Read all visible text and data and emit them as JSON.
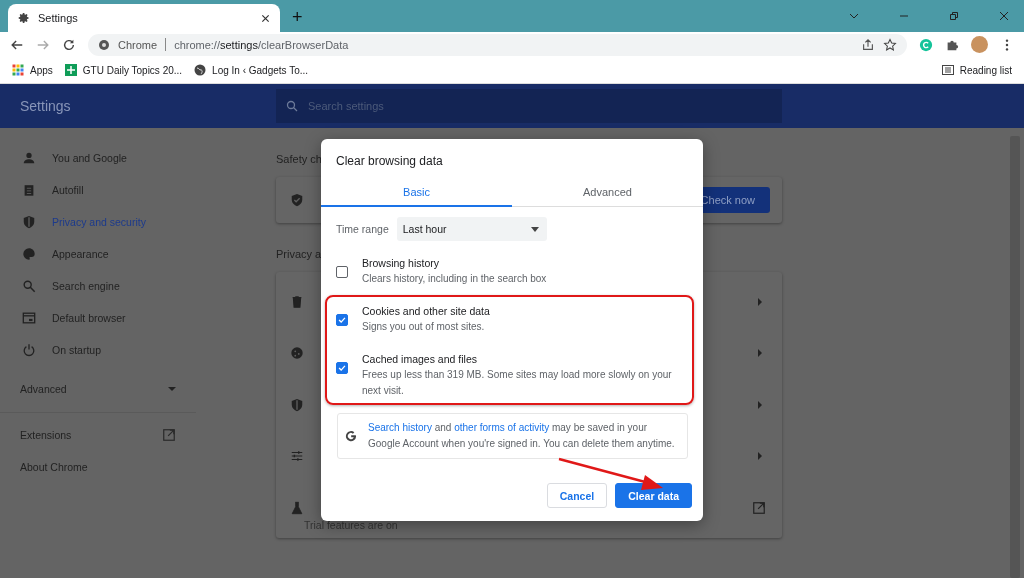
{
  "browser": {
    "tab_title": "Settings",
    "new_tab": "+",
    "site_label": "Chrome",
    "url_host": "chrome://",
    "url_bold": "settings",
    "url_path": "/clearBrowserData",
    "bookmarks": [
      {
        "label": "Apps"
      },
      {
        "label": "GTU Daily Topics 20..."
      },
      {
        "label": "Log In ‹ Gadgets To..."
      }
    ],
    "reading_list": "Reading list"
  },
  "settings": {
    "title": "Settings",
    "search_placeholder": "Search settings",
    "sidebar": {
      "items": [
        {
          "label": "You and Google",
          "selected": false
        },
        {
          "label": "Autofill",
          "selected": false
        },
        {
          "label": "Privacy and security",
          "selected": true
        },
        {
          "label": "Appearance",
          "selected": false
        },
        {
          "label": "Search engine",
          "selected": false
        },
        {
          "label": "Default browser",
          "selected": false
        },
        {
          "label": "On startup",
          "selected": false
        }
      ],
      "advanced": {
        "label": "Advanced",
        "expanded": false
      },
      "links": [
        {
          "label": "Extensions",
          "external": true
        },
        {
          "label": "About Chrome",
          "external": false
        }
      ]
    },
    "safety_heading": "Safety ch",
    "check_button": "Check now",
    "privacy_heading": "Privacy a",
    "privacy_trial_subtitle": "Trial features are on"
  },
  "dialog": {
    "title": "Clear browsing data",
    "tabs": [
      {
        "label": "Basic",
        "selected": true
      },
      {
        "label": "Advanced",
        "selected": false
      }
    ],
    "time_range": {
      "label": "Time range",
      "value": "Last hour"
    },
    "options": [
      {
        "title": "Browsing history",
        "description": "Clears history, including in the search box",
        "checked": false
      },
      {
        "title": "Cookies and other site data",
        "description": "Signs you out of most sites.",
        "checked": true
      },
      {
        "title": "Cached images and files",
        "description": "Frees up less than 319 MB. Some sites may load more slowly on your next visit.",
        "checked": true
      }
    ],
    "info": [
      {
        "kind": "link",
        "text": "Search history"
      },
      {
        "kind": "text",
        "text": " and "
      },
      {
        "kind": "link",
        "text": "other forms of activity"
      },
      {
        "kind": "text",
        "text": " may be saved in your Google Account when you're signed in. You can delete them anytime."
      }
    ],
    "buttons": [
      {
        "label": "Cancel",
        "kind": "secondary"
      },
      {
        "label": "Clear data",
        "kind": "primary"
      }
    ]
  }
}
